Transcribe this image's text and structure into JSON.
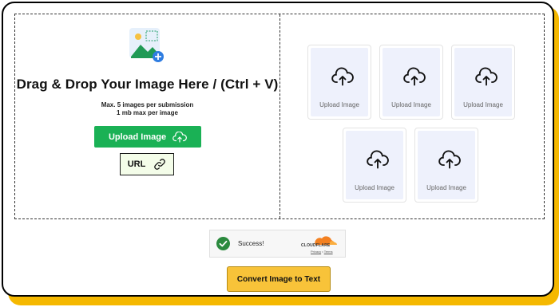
{
  "dropzone": {
    "title": "Drag & Drop Your Image Here / (Ctrl + V)",
    "limit_line1": "Max. 5 images per submission",
    "limit_line2": "1 mb max per image",
    "upload_button": "Upload Image",
    "url_button": "URL"
  },
  "slots": [
    {
      "label": "Upload Image"
    },
    {
      "label": "Upload Image"
    },
    {
      "label": "Upload Image"
    },
    {
      "label": "Upload Image"
    },
    {
      "label": "Upload Image"
    }
  ],
  "captcha": {
    "status": "Success!",
    "brand": "CLOUDFLARE",
    "privacy": "Privacy",
    "separator": "•",
    "terms": "Terms"
  },
  "convert_button": "Convert Image to Text",
  "colors": {
    "accent_green": "#1ab155",
    "accent_yellow": "#f5b800",
    "slot_bg": "#eef1fc"
  }
}
